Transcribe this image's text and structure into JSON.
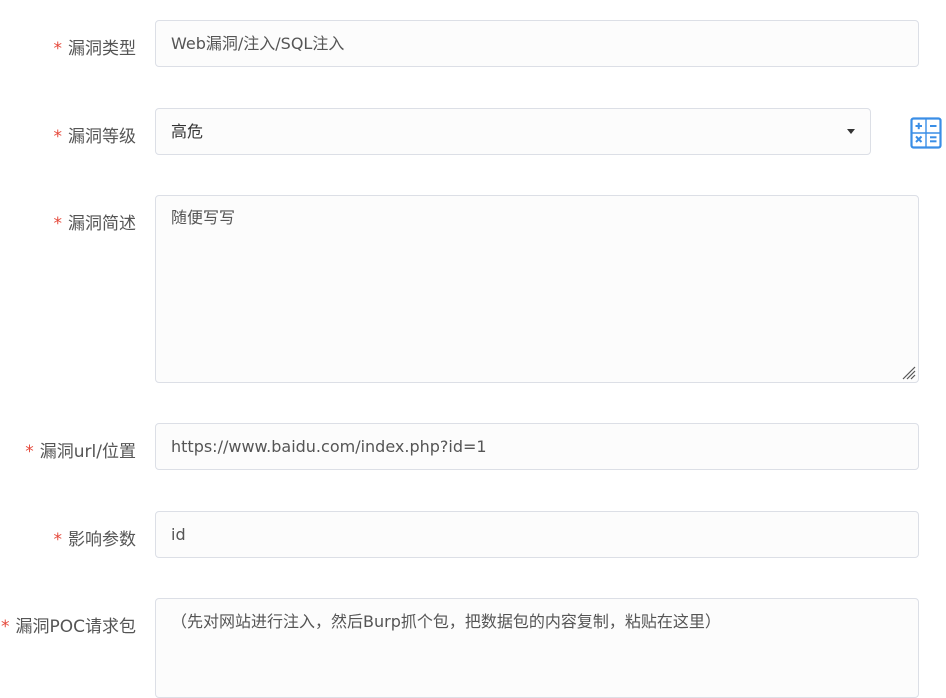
{
  "form": {
    "required_mark": "*",
    "vuln_type": {
      "label": "漏洞类型",
      "value": "Web漏洞/注入/SQL注入"
    },
    "vuln_level": {
      "label": "漏洞等级",
      "value": "高危"
    },
    "vuln_desc": {
      "label": "漏洞简述",
      "value": "随便写写"
    },
    "vuln_url": {
      "label": "漏洞url/位置",
      "value": "https://www.baidu.com/index.php?id=1"
    },
    "affected_param": {
      "label": "影响参数",
      "value": "id"
    },
    "poc_request": {
      "label": "漏洞POC请求包",
      "value": "（先对网站进行注入，然后Burp抓个包，把数据包的内容复制，粘贴在这里）"
    }
  },
  "icons": {
    "select_caret": "caret-down-icon",
    "textarea_resize": "resize-grip-icon",
    "calculator": "calculator-icon"
  },
  "colors": {
    "required": "#e5483a",
    "border": "#dcdfe6",
    "icon_blue": "#3a8ee6"
  }
}
